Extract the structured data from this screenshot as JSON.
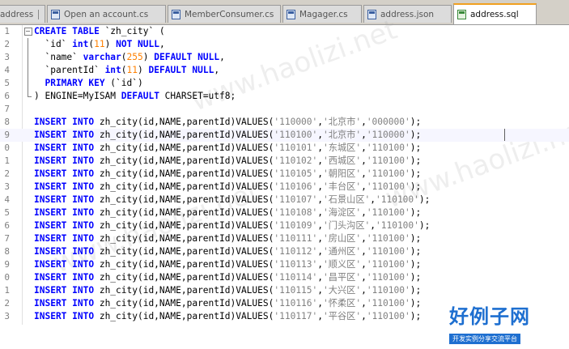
{
  "tabs": [
    {
      "label": "address",
      "active": false,
      "icon": "file-icon"
    },
    {
      "label": "Open an account.cs",
      "active": false,
      "icon": "file-icon"
    },
    {
      "label": "MemberConsumer.cs",
      "active": false,
      "icon": "file-icon"
    },
    {
      "label": "Magager.cs",
      "active": false,
      "icon": "file-icon"
    },
    {
      "label": "address.json",
      "active": false,
      "icon": "file-icon"
    },
    {
      "label": "address.sql",
      "active": true,
      "icon": "save-icon"
    }
  ],
  "line_numbers": [
    "1",
    "2",
    "3",
    "4",
    "5",
    "6",
    "7",
    "8",
    "9",
    "0",
    "1",
    "2",
    "3",
    "4",
    "5",
    "6",
    "7",
    "8",
    "9",
    "0",
    "1",
    "2",
    "3"
  ],
  "create_table": {
    "l1_kw": "CREATE TABLE",
    "l1_rest": " `zh_city` (",
    "l2_name": "  `id` ",
    "l2_type": "int",
    "l2_open": "(",
    "l2_num": "11",
    "l2_close": ") ",
    "l2_kw": "NOT NULL",
    "l2_end": ",",
    "l3_name": "  `name` ",
    "l3_type": "varchar",
    "l3_open": "(",
    "l3_num": "255",
    "l3_close": ") ",
    "l3_kw": "DEFAULT NULL",
    "l3_end": ",",
    "l4_name": "  `parentId` ",
    "l4_type": "int",
    "l4_open": "(",
    "l4_num": "11",
    "l4_close": ") ",
    "l4_kw": "DEFAULT NULL",
    "l4_end": ",",
    "l5_kw": "  PRIMARY KEY",
    "l5_rest": " (`id`)",
    "l6_a": ") ENGINE=MyISAM ",
    "l6_kw": "DEFAULT",
    "l6_b": " CHARSET=utf8;"
  },
  "insert_kw": "INSERT INTO",
  "insert_mid": " zh_city(id,NAME,parentId)VALUES(",
  "rows": [
    {
      "id": "'110000'",
      "name": "'北京市'",
      "parent": "'000000'",
      "tail": ");"
    },
    {
      "id": "'110100'",
      "name": "'北京市'",
      "parent": "'110000'",
      "tail": ");"
    },
    {
      "id": "'110101'",
      "name": "'东城区'",
      "parent": "'110100'",
      "tail": ");"
    },
    {
      "id": "'110102'",
      "name": "'西城区'",
      "parent": "'110100'",
      "tail": ");"
    },
    {
      "id": "'110105'",
      "name": "'朝阳区'",
      "parent": "'110100'",
      "tail": ");"
    },
    {
      "id": "'110106'",
      "name": "'丰台区'",
      "parent": "'110100'",
      "tail": ");"
    },
    {
      "id": "'110107'",
      "name": "'石景山区'",
      "parent": "'110100'",
      "tail": ");"
    },
    {
      "id": "'110108'",
      "name": "'海淀区'",
      "parent": "'110100'",
      "tail": ");"
    },
    {
      "id": "'110109'",
      "name": "'门头沟区'",
      "parent": "'110100'",
      "tail": ");"
    },
    {
      "id": "'110111'",
      "name": "'房山区'",
      "parent": "'110100'",
      "tail": ");"
    },
    {
      "id": "'110112'",
      "name": "'通州区'",
      "parent": "'110100'",
      "tail": ");"
    },
    {
      "id": "'110113'",
      "name": "'顺义区'",
      "parent": "'110100'",
      "tail": ");"
    },
    {
      "id": "'110114'",
      "name": "'昌平区'",
      "parent": "'110100'",
      "tail": ");"
    },
    {
      "id": "'110115'",
      "name": "'大兴区'",
      "parent": "'110100'",
      "tail": ");"
    },
    {
      "id": "'110116'",
      "name": "'怀柔区'",
      "parent": "'110100'",
      "tail": ");"
    },
    {
      "id": "'110117'",
      "name": "'平谷区'",
      "parent": "'110100'",
      "tail": ");"
    }
  ],
  "watermark": "www.haolizi.net",
  "logo": {
    "big": "好例子网",
    "small": "开发实例分享交流平台"
  },
  "colors": {
    "keyword": "#0000ff",
    "string": "#808080",
    "number": "#ff8000",
    "tab_accent": "#f0a020",
    "logo": "#1e6fd0"
  }
}
